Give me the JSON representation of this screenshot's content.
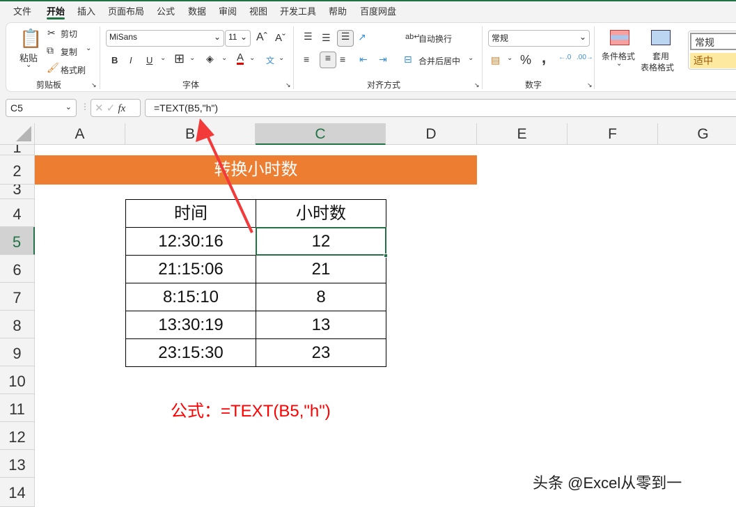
{
  "menu": [
    "文件",
    "开始",
    "插入",
    "页面布局",
    "公式",
    "数据",
    "审阅",
    "视图",
    "开发工具",
    "帮助",
    "百度网盘"
  ],
  "ribbon": {
    "clipboard": {
      "paste": "粘贴",
      "cut": "剪切",
      "copy": "复制",
      "format_painter": "格式刷",
      "group": "剪贴板"
    },
    "font": {
      "name": "MiSans",
      "size": "11",
      "bold": "B",
      "italic": "I",
      "underline": "U",
      "color_letter": "A",
      "phonetic": "文",
      "group": "字体",
      "font_color": "#e00000"
    },
    "align": {
      "wrap": "自动换行",
      "merge": "合并后居中",
      "group": "对齐方式"
    },
    "number": {
      "format": "常规",
      "percent": "%",
      "comma": ",",
      "group": "数字"
    },
    "styles": {
      "cond": "条件格式",
      "table_1": "套用",
      "table_2": "表格格式",
      "style_normal": "常规",
      "style_neutral": "适中"
    }
  },
  "formula_bar": {
    "name_box": "C5",
    "fx": "fx",
    "formula": "=TEXT(B5,\"h\")"
  },
  "columns": [
    "A",
    "B",
    "C",
    "D",
    "E",
    "F",
    "G"
  ],
  "rows": [
    "1",
    "2",
    "3",
    "4",
    "5",
    "6",
    "7",
    "8",
    "9",
    "10",
    "11",
    "12",
    "13",
    "14"
  ],
  "sheet": {
    "title": "转换小时数",
    "title_bg": "#ed7d31",
    "headers": [
      "时间",
      "小时数"
    ],
    "table": [
      [
        "12:30:16",
        "12"
      ],
      [
        "21:15:06",
        "21"
      ],
      [
        "8:15:10",
        "8"
      ],
      [
        "13:30:19",
        "13"
      ],
      [
        "23:15:30",
        "23"
      ]
    ],
    "note": "公式：=TEXT(B5,\"h\")"
  },
  "watermark": "头条 @Excel从零到一"
}
